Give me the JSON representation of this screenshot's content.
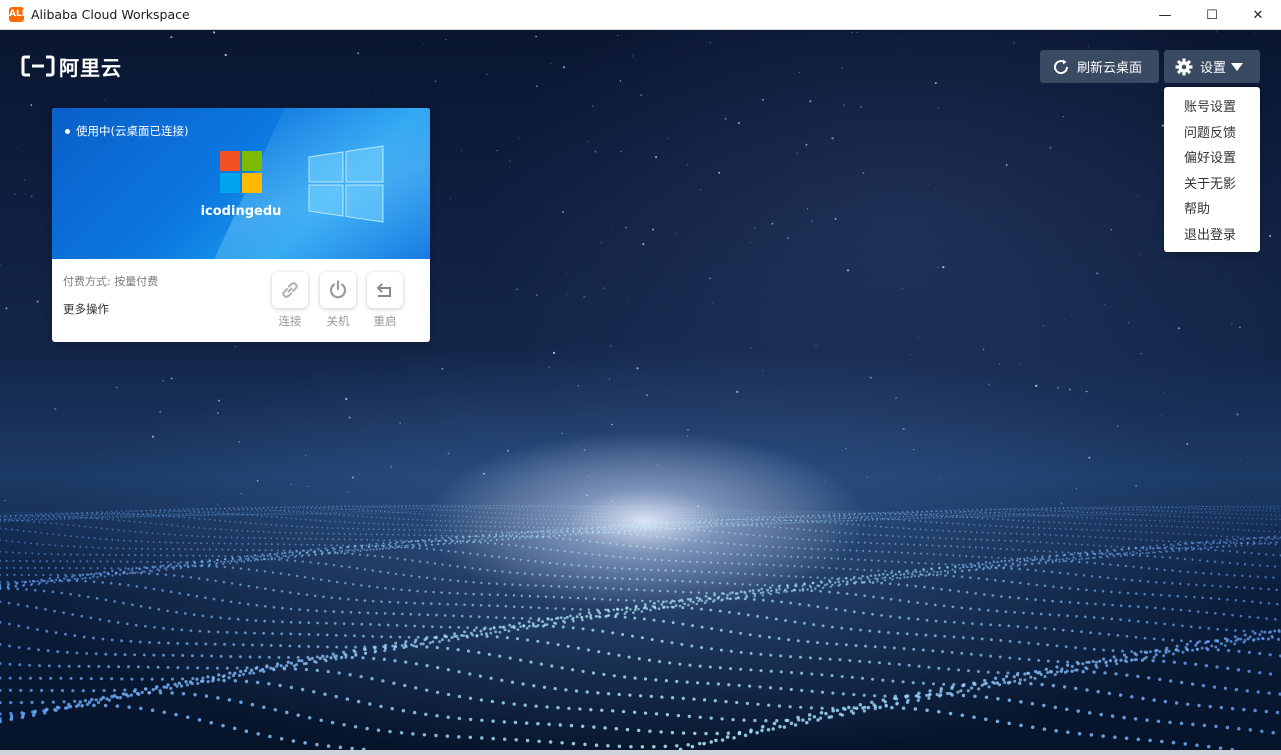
{
  "window": {
    "title": "Alibaba Cloud Workspace",
    "app_icon_text": "ALI",
    "minimize_glyph": "—",
    "maximize_glyph": "☐",
    "close_glyph": "✕"
  },
  "logo": {
    "text": "阿里云"
  },
  "toolbar": {
    "refresh_label": "刷新云桌面",
    "settings_label": "设置"
  },
  "settings_menu": {
    "items": [
      "账号设置",
      "问题反馈",
      "偏好设置",
      "关于无影",
      "帮助",
      "退出登录"
    ]
  },
  "desktop_card": {
    "status": "使用中(云桌面已连接)",
    "name": "icodingedu",
    "billing": "付费方式: 按量付费",
    "more_ops": "更多操作",
    "actions": [
      {
        "label": "连接",
        "icon": "link-icon"
      },
      {
        "label": "关机",
        "icon": "power-icon"
      },
      {
        "label": "重启",
        "icon": "restart-icon"
      }
    ]
  },
  "colors": {
    "accent_blue": "#0b78df",
    "button_bg": "#3b4a63",
    "ms_red": "#f25022",
    "ms_green": "#7fba00",
    "ms_blue": "#00a4ef",
    "ms_yellow": "#ffb900"
  }
}
